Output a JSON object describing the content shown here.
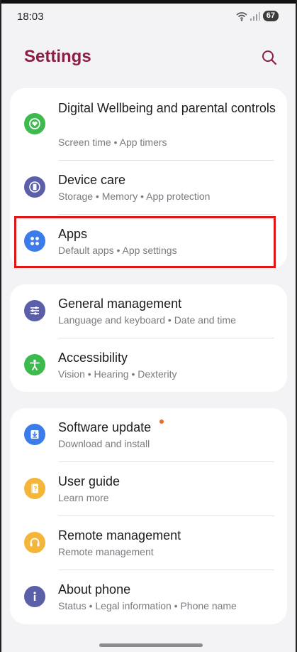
{
  "status_bar": {
    "time": "18:03",
    "battery": "67"
  },
  "header": {
    "title": "Settings"
  },
  "groups": [
    {
      "items": [
        {
          "title": "Digital Wellbeing and parental controls",
          "subtitle": "Screen time  •  App timers",
          "icon": "wellbeing-icon",
          "color": "#3dba4e"
        },
        {
          "title": "Device care",
          "subtitle": "Storage  •  Memory  •  App protection",
          "icon": "device-care-icon",
          "color": "#5b5fa8"
        },
        {
          "title": "Apps",
          "subtitle": "Default apps  •  App settings",
          "icon": "apps-icon",
          "color": "#3b7bea"
        }
      ]
    },
    {
      "items": [
        {
          "title": "General management",
          "subtitle": "Language and keyboard  •  Date and time",
          "icon": "sliders-icon",
          "color": "#5b5fa8"
        },
        {
          "title": "Accessibility",
          "subtitle": "Vision  •  Hearing  •  Dexterity",
          "icon": "accessibility-icon",
          "color": "#3dba4e"
        }
      ]
    },
    {
      "items": [
        {
          "title": "Software update",
          "subtitle": "Download and install",
          "icon": "download-icon",
          "color": "#3b7bea"
        },
        {
          "title": "User guide",
          "subtitle": "Learn more",
          "icon": "guide-icon",
          "color": "#f4b53b"
        },
        {
          "title": "Remote management",
          "subtitle": "Remote management",
          "icon": "headset-icon",
          "color": "#f4b53b"
        },
        {
          "title": "About phone",
          "subtitle": "Status  •  Legal information  •  Phone name",
          "icon": "info-icon",
          "color": "#5b5fa8"
        }
      ]
    }
  ],
  "colors": {
    "title": "#8a1e47",
    "highlight": "#e01616",
    "update_dot": "#f26b1d"
  }
}
